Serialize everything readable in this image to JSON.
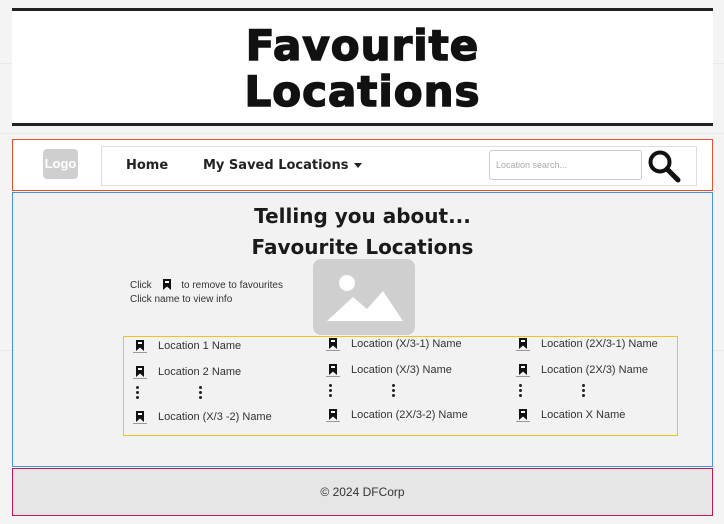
{
  "header": {
    "title_line1": "Favourite",
    "title_line2": "Locations"
  },
  "nav": {
    "logo": "Logo",
    "home": "Home",
    "saved": "My Saved Locations",
    "search_placeholder": "Location search..."
  },
  "main": {
    "title_line1": "Telling you about...",
    "title_line2": "Favourite Locations",
    "instruction_click": "Click",
    "instruction_remove": "to remove to favourites",
    "instruction_view": "Click name to view info",
    "columns": [
      [
        "Location 1 Name",
        "Location 2 Name",
        "Location (X/3 -2) Name"
      ],
      [
        "Location (X/3-1) Name",
        "Location (X/3)  Name",
        "Location (2X/3-2) Name"
      ],
      [
        "Location (2X/3-1) Name",
        "Location (2X/3)  Name",
        "Location X Name"
      ]
    ]
  },
  "footer": {
    "text": "©  2024 DFCorp"
  }
}
